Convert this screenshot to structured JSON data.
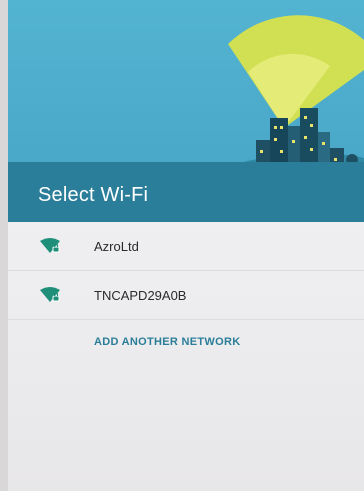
{
  "header": {
    "title": "Select Wi-Fi",
    "illustration_icon": "city-wifi-illustration"
  },
  "networks": [
    {
      "ssid": "AzroLtd",
      "icon": "wifi-locked-icon"
    },
    {
      "ssid": "TNCAPD29A0B",
      "icon": "wifi-locked-icon"
    }
  ],
  "actions": {
    "add_network_label": "ADD ANOTHER NETWORK"
  },
  "colors": {
    "header_bg": "#4aa8c8",
    "header_band": "#2b7e99",
    "accent": "#2b7e99",
    "wifi_icon": "#1f8f7a"
  }
}
